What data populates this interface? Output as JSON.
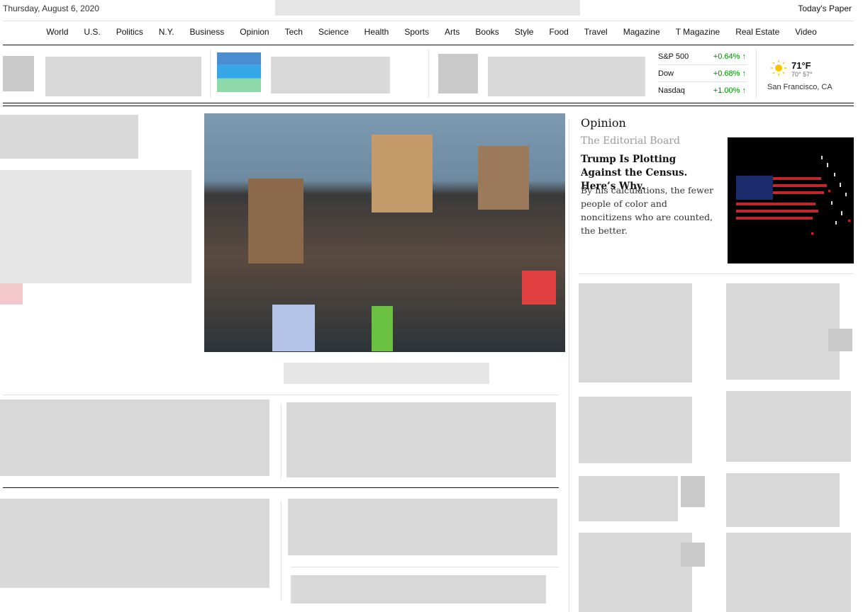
{
  "top": {
    "date": "Thursday, August 6, 2020",
    "todays_paper": "Today's Paper"
  },
  "nav": [
    "World",
    "U.S.",
    "Politics",
    "N.Y.",
    "Business",
    "Opinion",
    "Tech",
    "Science",
    "Health",
    "Sports",
    "Arts",
    "Books",
    "Style",
    "Food",
    "Travel",
    "Magazine",
    "T Magazine",
    "Real Estate",
    "Video"
  ],
  "markets": [
    {
      "name": "S&P 500",
      "value": "+0.64%",
      "arrow": "↑"
    },
    {
      "name": "Dow",
      "value": "+0.68%",
      "arrow": "↑"
    },
    {
      "name": "Nasdaq",
      "value": "+1.00%",
      "arrow": "↑"
    }
  ],
  "weather": {
    "icon": "sun-icon",
    "temp": "71°F",
    "high": "70°",
    "low": "57°",
    "city": "San Francisco, CA"
  },
  "opinion": {
    "label": "Opinion",
    "author": "The Editorial Board",
    "headline": "Trump Is Plotting Against the Census. Here’s Why.",
    "summary": "By his calculations, the fewer people of color and noncitizens who are counted, the better."
  },
  "colors": {
    "positive": "#008a00",
    "rule": "#e2e2e2"
  }
}
